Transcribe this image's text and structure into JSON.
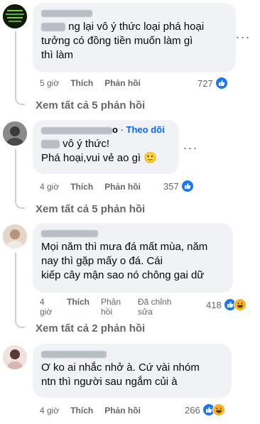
{
  "comments": [
    {
      "name_visible": "",
      "follow_label": "",
      "text_lines": [
        "ng lại vô ý thức loại phá hoại",
        "tưởng có đồng tiền muốn làm gì",
        "thì làm"
      ],
      "time": "5 giờ",
      "like_label": "Thích",
      "reply_label": "Phản hồi",
      "edited_label": "",
      "reaction_count": "727",
      "reactions": [
        "like-icon"
      ],
      "view_replies": "Xem tất cả 5 phản hồi"
    },
    {
      "name_visible": "o",
      "follow_label": "Theo dõi",
      "text_lines": [
        "vô ý thức!",
        "Phá hoại,vui vẻ  ao gì 🙂"
      ],
      "time": "4 giờ",
      "like_label": "Thích",
      "reply_label": "Phản hồi",
      "edited_label": "",
      "reaction_count": "357",
      "reactions": [
        "like-icon"
      ],
      "view_replies": "Xem tất cả 5 phản hồi"
    },
    {
      "name_visible": "",
      "follow_label": "",
      "text_lines": [
        "Mọi năm thì mưa đá mất mùa, năm",
        "nay thì gặp mấy  o đá. Cái",
        "kiếp cây mận sao nó chông gai dữ"
      ],
      "time": "4 giờ",
      "like_label": "Thích",
      "reply_label": "Phản hồi",
      "edited_label": "Đã chỉnh sửa",
      "reaction_count": "418",
      "reactions": [
        "like-icon",
        "haha-icon"
      ],
      "view_replies": "Xem tất cả 2 phản hồi"
    },
    {
      "name_visible": "",
      "follow_label": "",
      "text_lines": [
        "Ơ ko ai nhắc nhở à. Cứ vài nhóm",
        "ntn thì người sau ngắm củi à"
      ],
      "time": "4 giờ",
      "like_label": "Thích",
      "reply_label": "Phản hồi",
      "edited_label": "",
      "reaction_count": "266",
      "reactions": [
        "like-icon",
        "haha-icon"
      ],
      "view_replies": ""
    }
  ],
  "colors": {
    "bubble": "#f0f2f5",
    "like": "#1877f2",
    "haha": "#f7b125",
    "follow": "#0866ff",
    "meta": "#65676b"
  }
}
